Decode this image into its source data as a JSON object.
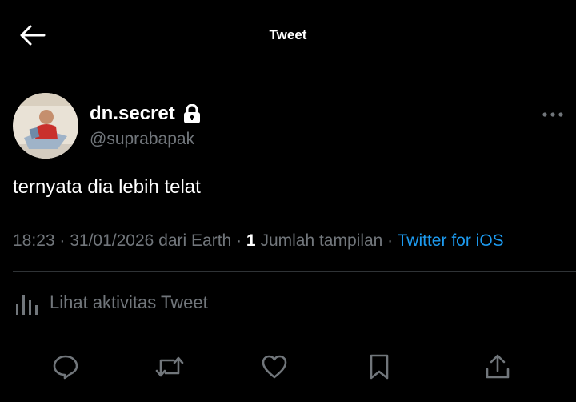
{
  "header": {
    "title": "Tweet",
    "back_icon": "arrow-left-icon"
  },
  "author": {
    "display_name": "dn.secret",
    "handle": "@suprabapak",
    "protected_icon": "lock-icon",
    "avatar_icon": "profile-photo",
    "more_icon": "more-horizontal-icon"
  },
  "tweet": {
    "text": "ternyata dia lebih telat"
  },
  "meta": {
    "time": "18:23",
    "date": "31/01/2026",
    "location": "dari Earth",
    "separator": " · ",
    "views_count": "1",
    "views_label": "Jumlah tampilan",
    "source": "Twitter for iOS"
  },
  "activity": {
    "label": "Lihat aktivitas Tweet",
    "icon": "analytics-bars-icon"
  },
  "actions": {
    "reply_icon": "reply-icon",
    "retweet_icon": "retweet-icon",
    "like_icon": "heart-icon",
    "bookmark_icon": "bookmark-icon",
    "share_icon": "share-icon"
  },
  "colors": {
    "background": "#000000",
    "text_primary": "#ffffff",
    "text_secondary": "#71767b",
    "link": "#1d9bf0",
    "divider": "#2f3336"
  }
}
